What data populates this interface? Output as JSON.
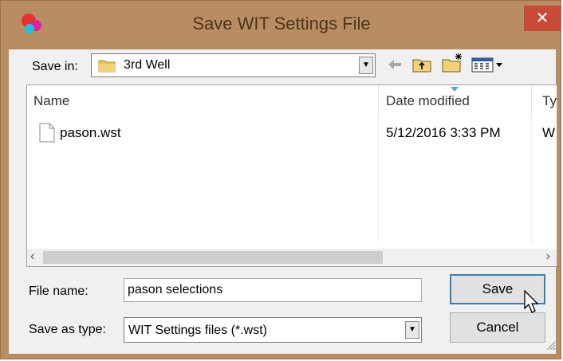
{
  "window": {
    "title": "Save WIT Settings File",
    "close_glyph": "✕",
    "title_color": "#b98d62",
    "close_color": "#c84b3a"
  },
  "save_in": {
    "label": "Save in:",
    "value": "3rd Well",
    "icon": "folder-icon"
  },
  "toolbar": {
    "icons": [
      "back-arrow-icon",
      "up-folder-icon",
      "new-folder-icon",
      "view-menu-icon"
    ]
  },
  "list": {
    "columns": [
      "Name",
      "Date modified",
      "Ty"
    ],
    "files": [
      {
        "name": "pason.wst",
        "date_modified": "5/12/2016 3:33 PM",
        "type": "W"
      }
    ]
  },
  "file_name": {
    "label": "File name:",
    "value": "pason selections"
  },
  "save_as_type": {
    "label": "Save as type:",
    "value": "WIT Settings files (*.wst)"
  },
  "buttons": {
    "save": "Save",
    "cancel": "Cancel"
  }
}
